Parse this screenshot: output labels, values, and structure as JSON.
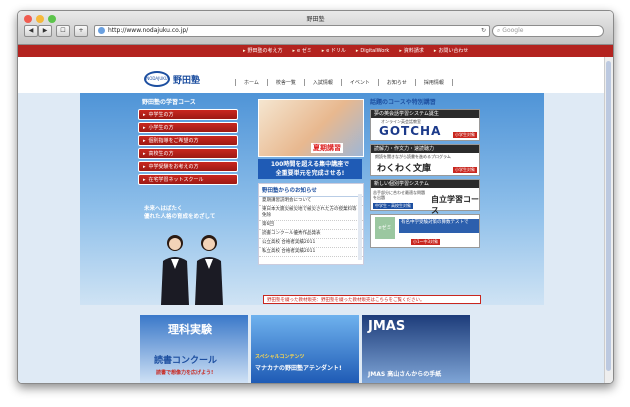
{
  "window": {
    "title": "野田塾"
  },
  "toolbar": {
    "url": "http://www.nodajuku.co.jp/",
    "search_placeholder": "Google",
    "back": "◀",
    "forward": "▶",
    "bookmark": "☐",
    "add": "+"
  },
  "topnav": [
    "野田塾の考え方",
    "e ゼミ",
    "e ドリル",
    "DigitalWork",
    "資料請求",
    "お問い合わせ"
  ],
  "logo": {
    "mark": "NODAJUKU",
    "name": "野田塾"
  },
  "mainnav": [
    "ホーム",
    "校舎一覧",
    "入試情報",
    "イベント",
    "お知らせ",
    "採用情報"
  ],
  "left": {
    "heading": "野田塾の学習コース",
    "menu": [
      "中学生の方",
      "小学生の方",
      "個別指導をご希望の方",
      "高校生の方",
      "中学受験をお考えの方",
      "在宅学習ネットスクール"
    ],
    "slogan": [
      "未来へはばたく",
      "優れた人格の育成をめざして"
    ]
  },
  "middle": {
    "photo_title": "夏期講習",
    "promo": [
      "100時間を超える集中講座で",
      "全重要単元を完成させる!"
    ],
    "news_heading": "野田塾からのお知らせ",
    "news": [
      "夏期講習説明会について",
      "東日本大震災被災地で被災された方の授業料等免除",
      "第6回",
      "読書コンクール優秀作品発表",
      "公立高校 合格者実績2011",
      "私立高校 合格者実績2011"
    ]
  },
  "right": {
    "heading": "話題のコースや特別講習",
    "boxes": [
      {
        "bar": "夢の英会話学習システム誕生",
        "text": "GOTCHA",
        "sub": "オンライン英会話教室",
        "tag": "小学生対象"
      },
      {
        "bar": "読解力・作文力・速読聴力",
        "text": "わくわく文庫",
        "sub": "朗読を聞きながら読書を進めるプログラム",
        "tag": "小学生対象"
      },
      {
        "bar": "新しい個別学習システム",
        "text": "自立学習コース",
        "sub": "苦手部分に合わせ最適な問題を出題",
        "tag": "中学生・高校生対象"
      },
      {
        "bar": "",
        "text": "eゼミ",
        "sub": "有名中学受験対策の算数テストで",
        "tag": "小1〜中3対象"
      }
    ]
  },
  "bottom_note": "野田塾を綴った教材販売：野田塾を綴った教材販売はこちらをご覧ください。",
  "banners": [
    {
      "title": "理科実験",
      "sub": "読書コンクール",
      "note": "読書で想像力を広げよう!"
    },
    {
      "title": "スペシャルコンテンツ",
      "sub": "マナカナの野田塾アテンダント!"
    },
    {
      "title": "JMAS",
      "sub": "JMAS 高山さんからの手紙"
    }
  ],
  "colors": {
    "accent_red": "#b3231f",
    "brand_blue": "#1d4fa0"
  }
}
